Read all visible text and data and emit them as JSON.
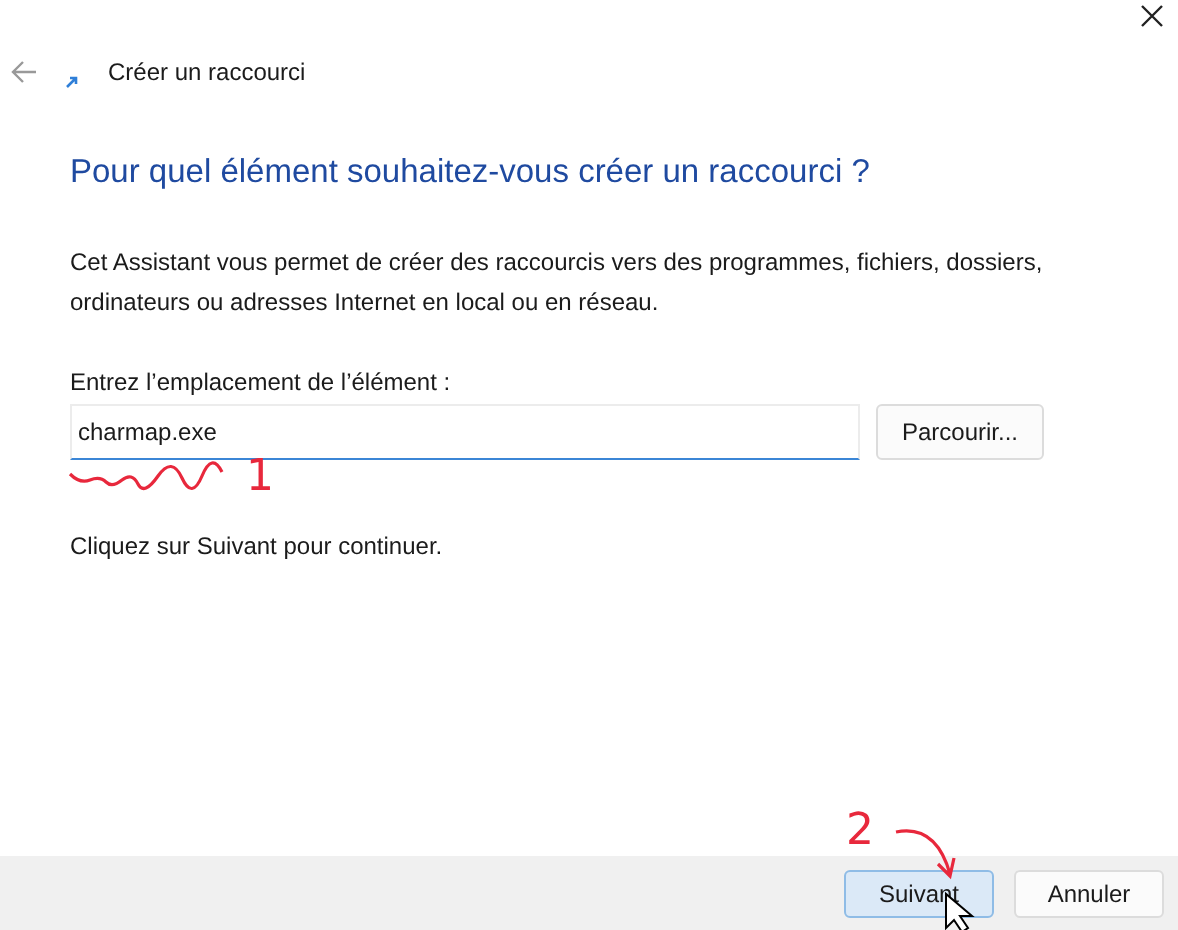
{
  "window": {
    "title": "Créer un raccourci"
  },
  "heading": "Pour quel élément souhaitez-vous créer un raccourci ?",
  "description": "Cet Assistant vous permet de créer des raccourcis vers des programmes, fichiers, dossiers, ordinateurs ou adresses Internet en local ou en réseau.",
  "location": {
    "label": "Entrez l’emplacement de l’élément :",
    "value": "charmap.exe",
    "focused": true,
    "browse_button": "Parcourir..."
  },
  "hint": "Cliquez sur Suivant pour continuer.",
  "buttons": [
    {
      "label": "Suivant",
      "default": true
    },
    {
      "label": "Annuler",
      "default": false
    }
  ],
  "annotations": [
    {
      "label": "1",
      "kind": "underline"
    },
    {
      "label": "2",
      "kind": "arrow"
    }
  ]
}
